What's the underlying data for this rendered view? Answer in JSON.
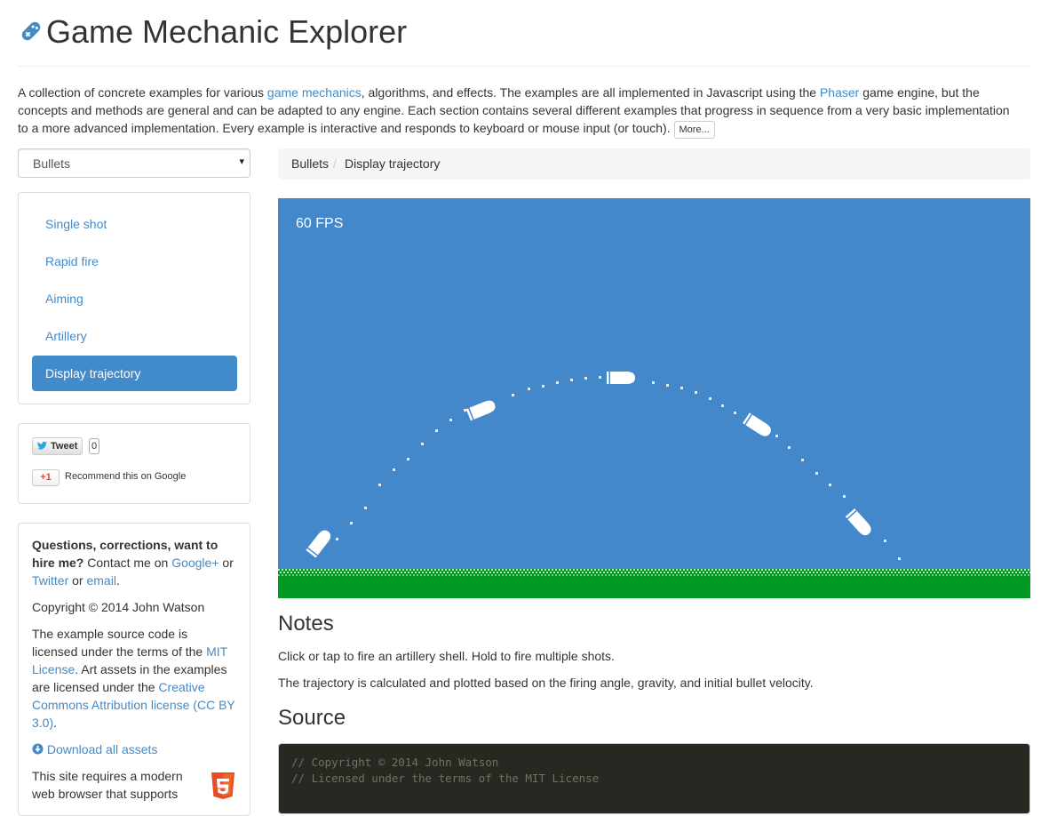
{
  "header": {
    "title": "Game Mechanic Explorer",
    "logo_icon": "game-controller-icon"
  },
  "intro": {
    "t1": "A collection of concrete examples for various ",
    "link1": "game mechanics",
    "t2": ", algorithms, and effects. The examples are all implemented in Javascript using the ",
    "link2": "Phaser",
    "t3": " game engine, but the concepts and methods are general and can be adapted to any engine. Each section contains several different examples that progress in sequence from a very basic implementation to a more advanced implementation. Every example is interactive and responds to keyboard or mouse input (or touch).",
    "more_label": "More..."
  },
  "category_select": {
    "value": "Bullets",
    "caret": "▾"
  },
  "nav": {
    "items": [
      {
        "label": "Single shot",
        "active": false
      },
      {
        "label": "Rapid fire",
        "active": false
      },
      {
        "label": "Aiming",
        "active": false
      },
      {
        "label": "Artillery",
        "active": false
      },
      {
        "label": "Display trajectory",
        "active": true
      }
    ]
  },
  "social": {
    "tweet_label": "Tweet",
    "tweet_count": "0",
    "gplus_label": "+1",
    "gplus_text": "Recommend this on Google"
  },
  "info": {
    "q_bold": "Questions, corrections, want to hire me?",
    "q_t1": " Contact me on ",
    "q_link1": "Google+",
    "q_t2": " or ",
    "q_link2": "Twitter",
    "q_t3": " or ",
    "q_link3": "email",
    "q_t4": ".",
    "copyright": "Copyright © 2014 John Watson",
    "lic_t1": "The example source code is licensed under the terms of the ",
    "lic_link1": "MIT License",
    "lic_t2": ". Art assets in the examples are licensed under the ",
    "lic_link2": "Creative Commons Attribution license (CC BY 3.0)",
    "lic_t3": ".",
    "download_label": "Download all assets",
    "browser_text": "This site requires a modern web browser that supports"
  },
  "breadcrumb": {
    "section": "Bullets",
    "separator": "/",
    "page": "Display trajectory"
  },
  "game": {
    "fps": "60 FPS",
    "colors": {
      "sky": "#4488cc",
      "ground": "#009922",
      "bullet": "#ffffff"
    }
  },
  "notes": {
    "heading": "Notes",
    "line1": "Click or tap to fire an artillery shell. Hold to fire multiple shots.",
    "line2": "The trajectory is calculated and plotted based on the firing angle, gravity, and initial bullet velocity."
  },
  "source": {
    "heading": "Source",
    "code_line1": "// Copyright © 2014 John Watson",
    "code_line2": "// Licensed under the terms of the MIT License"
  }
}
